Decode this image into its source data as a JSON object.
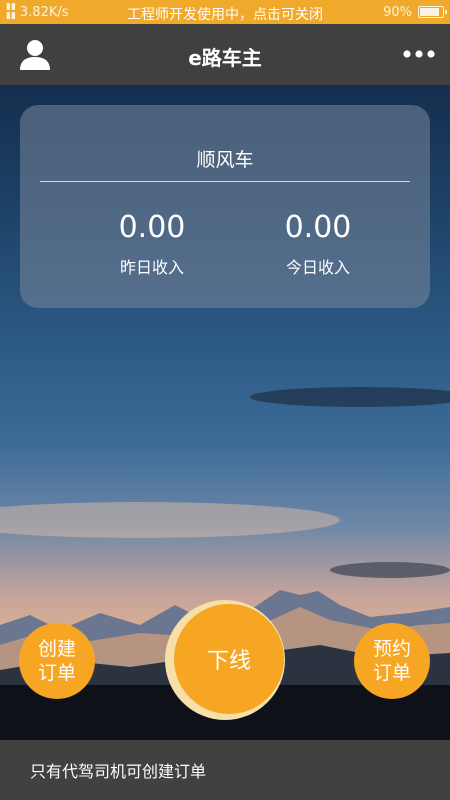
{
  "status_bar": {
    "speed": "3.82K/s",
    "notice": "工程师开发使用中，点击可关闭",
    "battery_percent": "90%",
    "battery_level": 0.9
  },
  "header": {
    "title": "e路车主",
    "left_icon": "user-icon",
    "right_icon": "more-icon"
  },
  "card": {
    "title": "顺风车",
    "stats": [
      {
        "value": "0.00",
        "label": "昨日收入"
      },
      {
        "value": "0.00",
        "label": "今日收入"
      }
    ]
  },
  "actions": {
    "create_order": "创建订单",
    "go_offline": "下线",
    "book_order": "预约订单"
  },
  "footer": {
    "message": "只有代驾司机可创建订单"
  },
  "colors": {
    "accent": "#f6a623",
    "header_bg": "#404040",
    "status_bar_bg": "#f0a92a"
  }
}
